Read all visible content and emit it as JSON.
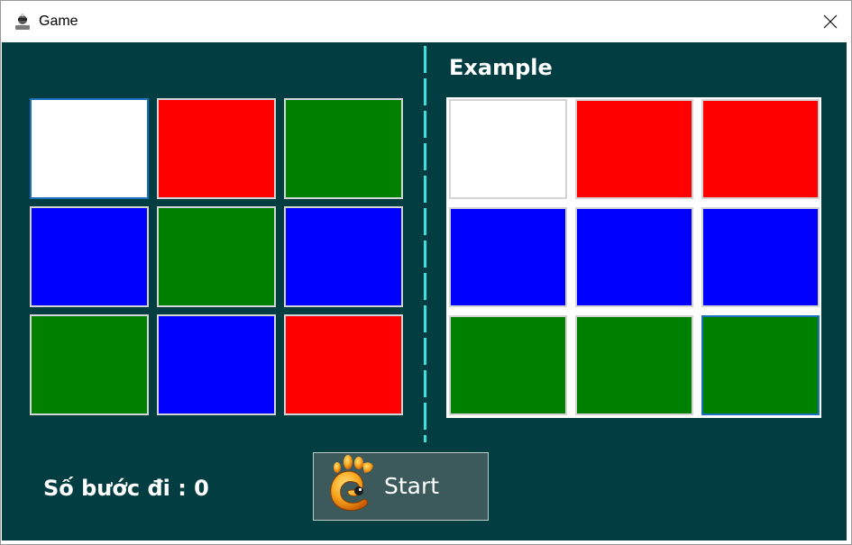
{
  "window": {
    "title": "Game",
    "app_icon": "person-avatar-icon",
    "close_icon": "close-icon"
  },
  "colors": {
    "white": "#ffffff",
    "red": "#ff0000",
    "green": "#008000",
    "blue": "#0000ff",
    "background": "#023d42",
    "divider": "#3fe0e0"
  },
  "game_board": {
    "cells": [
      "white",
      "red",
      "green",
      "blue",
      "green",
      "blue",
      "green",
      "blue",
      "red"
    ]
  },
  "example": {
    "label": "Example",
    "cells": [
      "white",
      "red",
      "red",
      "blue",
      "blue",
      "blue",
      "green",
      "green",
      "green"
    ]
  },
  "status": {
    "steps_label": "Số bước đi : 0"
  },
  "start_button": {
    "label": "Start",
    "icon": "gimp-logo-icon"
  }
}
